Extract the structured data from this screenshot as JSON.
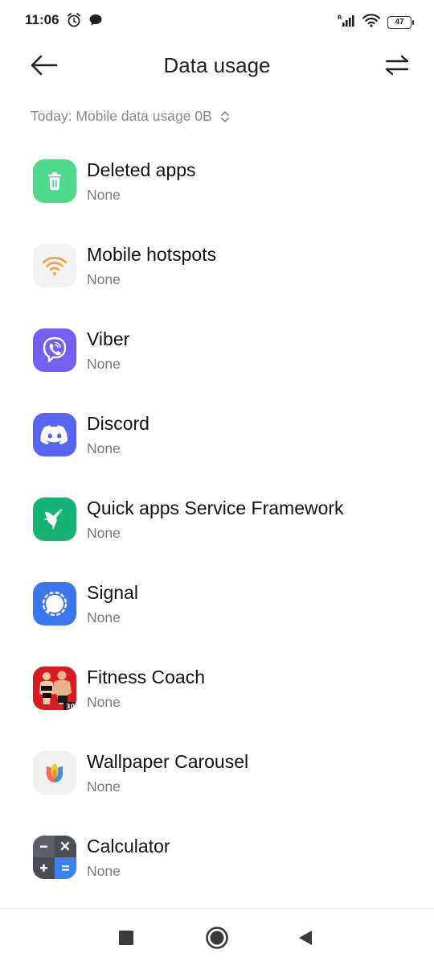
{
  "status_bar": {
    "time": "11:06",
    "battery": "47"
  },
  "header": {
    "title": "Data usage"
  },
  "summary": {
    "text": "Today: Mobile data usage 0B"
  },
  "apps": [
    {
      "name": "Deleted apps",
      "usage": "None"
    },
    {
      "name": "Mobile hotspots",
      "usage": "None"
    },
    {
      "name": "Viber",
      "usage": "None"
    },
    {
      "name": "Discord",
      "usage": "None"
    },
    {
      "name": "Quick apps Service Framework",
      "usage": "None"
    },
    {
      "name": "Signal",
      "usage": "None"
    },
    {
      "name": "Fitness Coach",
      "usage": "None"
    },
    {
      "name": "Wallpaper Carousel",
      "usage": "None"
    },
    {
      "name": "Calculator",
      "usage": "None"
    }
  ],
  "icons": {
    "deleted_apps": "trash-icon",
    "mobile_hotspots": "wifi-icon",
    "viber": "viber-icon",
    "discord": "discord-icon",
    "quick_apps": "hummingbird-icon",
    "signal": "signal-icon",
    "fitness": "fitness-icon",
    "wallpaper": "tulip-icon",
    "calculator": "calculator-icon"
  },
  "colors": {
    "deleted_apps": "#4fd98a",
    "viber": "#7360f2",
    "discord": "#5865f2",
    "quick_apps": "#17b374",
    "signal": "#3a76f0",
    "hotspot_orange": "#f2a33a"
  }
}
